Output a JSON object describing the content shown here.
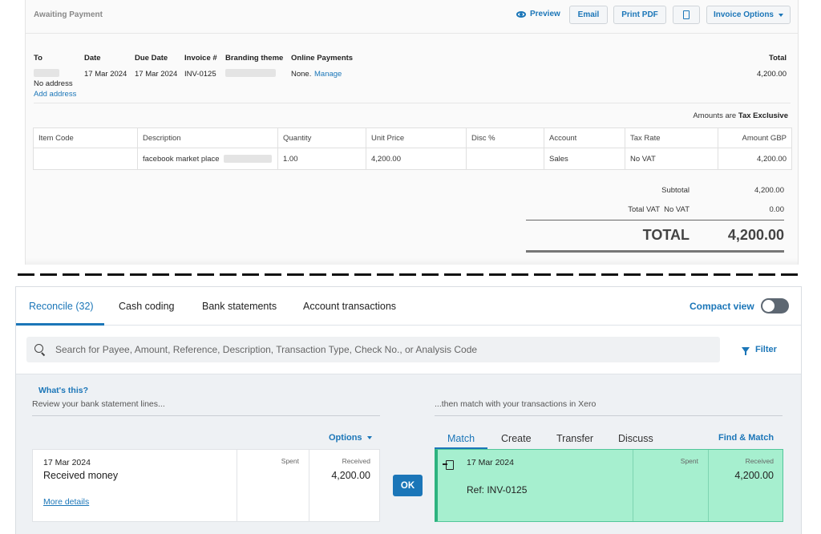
{
  "invoice": {
    "status": "Awaiting Payment",
    "actions": {
      "preview": "Preview",
      "email": "Email",
      "print_pdf": "Print PDF",
      "invoice_options": "Invoice Options"
    },
    "headers": {
      "to": "To",
      "date": "Date",
      "due_date": "Due Date",
      "invoice_no": "Invoice #",
      "branding_theme": "Branding theme",
      "online_payments": "Online Payments",
      "total": "Total"
    },
    "values": {
      "no_address": "No address",
      "add_address": "Add address",
      "date": "17 Mar 2024",
      "due_date": "17 Mar 2024",
      "invoice_no": "INV-0125",
      "online_payments": "None.",
      "manage": "Manage",
      "total": "4,200.00"
    },
    "amounts_are_label": "Amounts are",
    "amounts_are_value": "Tax Exclusive",
    "table": {
      "columns": [
        "Item Code",
        "Description",
        "Quantity",
        "Unit Price",
        "Disc %",
        "Account",
        "Tax Rate",
        "Amount GBP"
      ],
      "row": {
        "item_code": "",
        "description": "facebook market place",
        "quantity": "1.00",
        "unit_price": "4,200.00",
        "disc": "",
        "account": "Sales",
        "tax_rate": "No VAT",
        "amount": "4,200.00"
      }
    },
    "summary": {
      "subtotal_label": "Subtotal",
      "subtotal_value": "4,200.00",
      "vat_label": "Total VAT  No VAT",
      "vat_value": "0.00",
      "total_label": "TOTAL",
      "total_value": "4,200.00"
    }
  },
  "reconcile": {
    "tabs": [
      "Reconcile (32)",
      "Cash coding",
      "Bank statements",
      "Account transactions"
    ],
    "compact_view": "Compact view",
    "search_placeholder": "Search for Payee, Amount, Reference, Description, Transaction Type, Check No., or Analysis Code",
    "filter": "Filter",
    "whats_this": "What's this?",
    "review_text": "Review your bank statement lines...",
    "match_text": "...then match with your transactions in Xero",
    "options": "Options",
    "statement": {
      "date": "17 Mar 2024",
      "description": "Received money",
      "more_details": "More details",
      "spent_label": "Spent",
      "received_label": "Received",
      "received_value": "4,200.00"
    },
    "ok": "OK",
    "match_tabs": [
      "Match",
      "Create",
      "Transfer",
      "Discuss"
    ],
    "find_match": "Find & Match",
    "match_item": {
      "date": "17 Mar 2024",
      "ref": "Ref: INV-0125",
      "spent_label": "Spent",
      "received_label": "Received",
      "received_value": "4,200.00"
    }
  },
  "colors": {
    "accent": "#1b76b8",
    "match_green": "#a6efcf",
    "match_border": "#2db37f"
  }
}
